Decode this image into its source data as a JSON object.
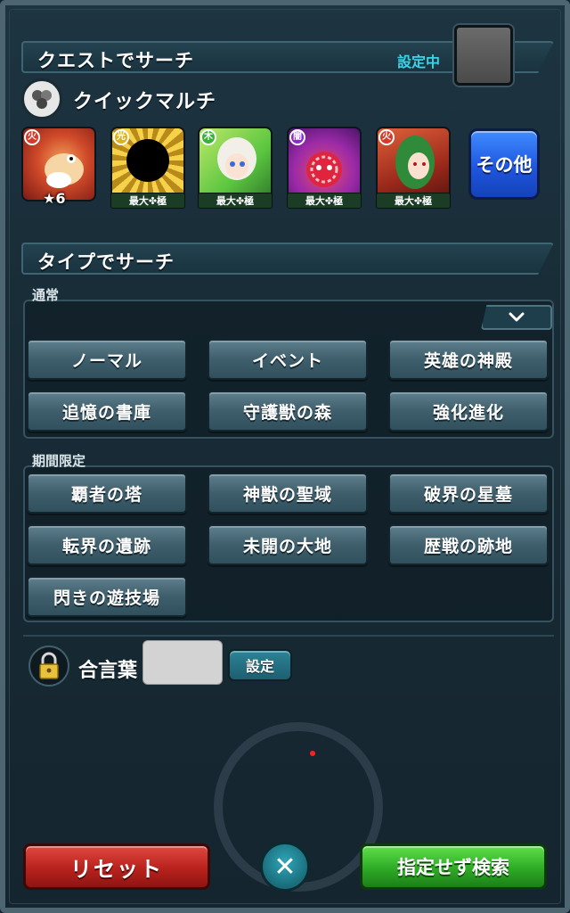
{
  "quest_search": {
    "title": "クエストでサーチ",
    "status": "設定中"
  },
  "quick_multi": {
    "label": "クイックマルチ"
  },
  "monsters": [
    {
      "name": "monster-slot-1",
      "attribute": "fire",
      "star_label": "★6",
      "badge": ""
    },
    {
      "name": "monster-slot-2",
      "attribute": "light",
      "star_label": "",
      "badge": "最大✤極"
    },
    {
      "name": "monster-slot-3",
      "attribute": "wood",
      "star_label": "",
      "badge": "最大✤極"
    },
    {
      "name": "monster-slot-4",
      "attribute": "dark",
      "star_label": "",
      "badge": "最大✤極"
    },
    {
      "name": "monster-slot-5",
      "attribute": "fire",
      "star_label": "",
      "badge": "最大✤極"
    }
  ],
  "other_button": "その他",
  "type_search": {
    "title": "タイプでサーチ"
  },
  "normal": {
    "label": "通常",
    "chips": [
      "ノーマル",
      "イベント",
      "英雄の神殿",
      "追憶の書庫",
      "守護獣の森",
      "強化進化"
    ]
  },
  "limited": {
    "label": "期間限定",
    "chips": [
      "覇者の塔",
      "神獣の聖域",
      "破界の星墓",
      "転界の遺跡",
      "未開の大地",
      "歴戦の跡地",
      "閃きの遊技場"
    ]
  },
  "password": {
    "label": "合言葉",
    "value": "",
    "set_button": "設定"
  },
  "footer": {
    "reset_button": "リセット",
    "close_symbol": "✕",
    "search_button": "指定せず検索"
  },
  "colors": {
    "accent_cyan": "#39d4e8",
    "reset_red": "#b8221d",
    "search_green": "#2eaa26",
    "other_blue": "#1f56e0"
  }
}
